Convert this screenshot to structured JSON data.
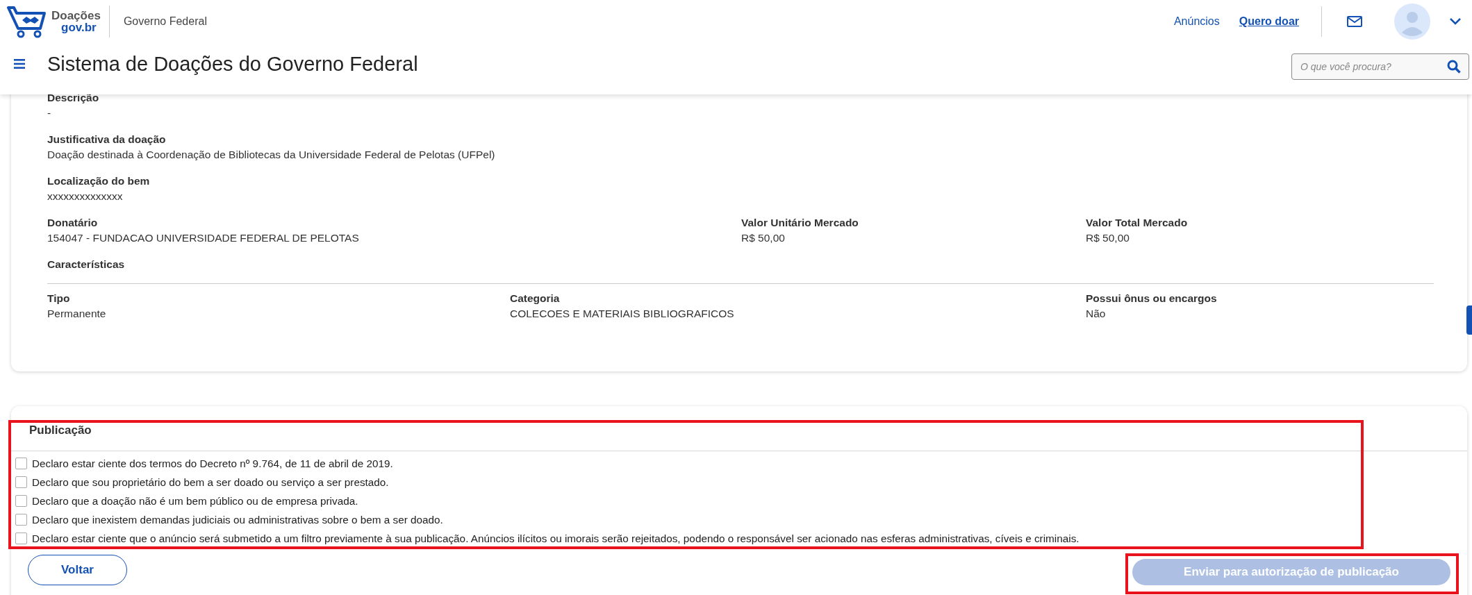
{
  "header": {
    "logo": {
      "line_1": "Doações",
      "line_2": "gov.br"
    },
    "org": "Governo Federal",
    "links": [
      {
        "label": "Anúncios",
        "selected": false
      },
      {
        "label": "Quero doar",
        "selected": true
      }
    ],
    "title": "Sistema de Doações do Governo Federal",
    "search": {
      "placeholder": "O que você procura?"
    }
  },
  "details": {
    "blocks": [
      {
        "label": "Descrição",
        "value": "-"
      },
      {
        "label": "Justificativa da doação",
        "value": "Doação destinada à Coordenação de Bibliotecas da Universidade Federal de Pelotas (UFPel)"
      },
      {
        "label": "Localização do bem",
        "value": "xxxxxxxxxxxxxx"
      }
    ],
    "row_1": [
      {
        "label": "Donatário",
        "value": "154047 - FUNDACAO UNIVERSIDADE FEDERAL DE PELOTAS"
      },
      {
        "label": "Valor Unitário Mercado",
        "value": "R$ 50,00"
      },
      {
        "label": "Valor Total Mercado",
        "value": "R$ 50,00"
      }
    ],
    "section": "Características",
    "row_2": [
      {
        "label": "Tipo",
        "value": "Permanente"
      },
      {
        "label": "Categoria",
        "value": "COLECOES E MATERIAIS BIBLIOGRAFICOS"
      },
      {
        "label": "Possui ônus ou encargos",
        "value": "Não"
      }
    ]
  },
  "publication": {
    "title": "Publicação",
    "declarations": [
      {
        "text": "Declaro estar ciente dos termos do Decreto nº 9.764, de 11 de abril de 2019.",
        "checked": false
      },
      {
        "text": "Declaro que sou proprietário do bem a ser doado ou serviço a ser prestado.",
        "checked": false
      },
      {
        "text": "Declaro que a doação não é um bem público ou de empresa privada.",
        "checked": false
      },
      {
        "text": "Declaro que inexistem demandas judiciais ou administrativas sobre o bem a ser doado.",
        "checked": false
      },
      {
        "text": "Declaro estar ciente que o anúncio será submetido a um filtro previamente à sua publicação. Anúncios ilícitos ou imorais serão rejeitados, podendo o responsável ser acionado nas esferas administrativas, cíveis e criminais.",
        "checked": false
      }
    ],
    "back_button": {
      "label": "Voltar",
      "disabled": false
    },
    "submit_button": {
      "label": "Enviar para autorização de publicação",
      "disabled": true
    }
  }
}
